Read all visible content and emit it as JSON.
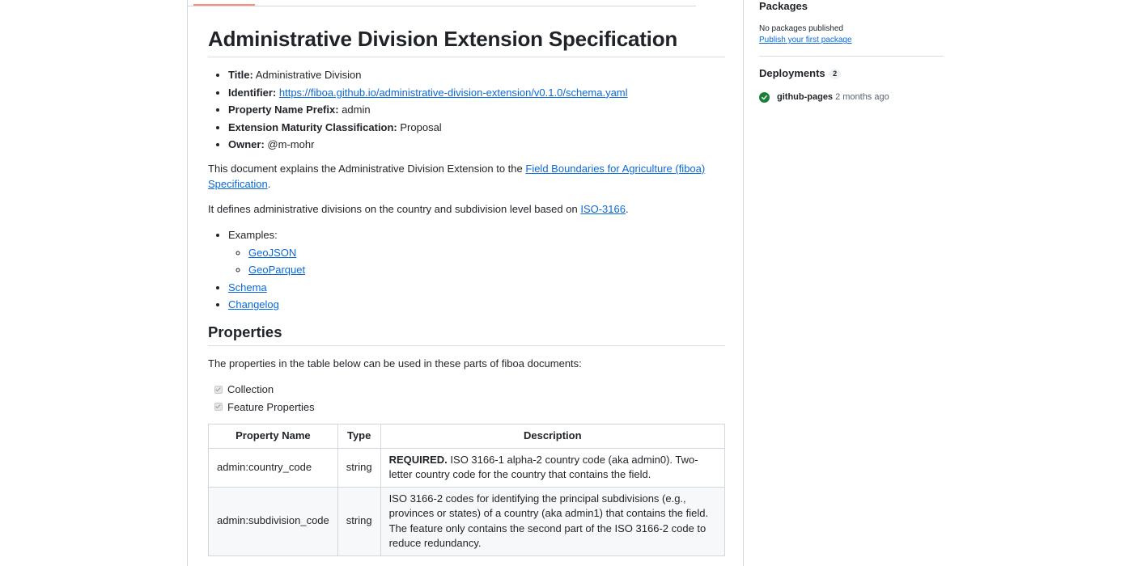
{
  "readme": {
    "title": "Administrative Division Extension Specification",
    "meta": [
      {
        "label": "Title:",
        "value": "Administrative Division"
      },
      {
        "label": "Identifier:",
        "value": "https://fiboa.github.io/administrative-division-extension/v0.1.0/schema.yaml"
      },
      {
        "label": "Property Name Prefix:",
        "value": "admin"
      },
      {
        "label": "Extension Maturity Classification:",
        "value": "Proposal"
      },
      {
        "label": "Owner:",
        "value": "@m-mohr"
      }
    ],
    "intro": {
      "before": "This document explains the Administrative Division Extension to the ",
      "link": "Field Boundaries for Agriculture (fiboa) Specification",
      "after": "."
    },
    "defines": {
      "before": "It defines administrative divisions on the country and subdivision level based on ",
      "link": "ISO-3166",
      "after": "."
    },
    "links": {
      "examples_label": "Examples:",
      "examples": [
        "GeoJSON",
        "GeoParquet"
      ],
      "schema": "Schema",
      "changelog": "Changelog"
    },
    "properties_heading": "Properties",
    "properties_intro": "The properties in the table below can be used in these parts of fiboa documents:",
    "usage": [
      "Collection",
      "Feature Properties"
    ],
    "table": {
      "headers": [
        "Property Name",
        "Type",
        "Description"
      ],
      "rows": [
        {
          "name": "admin:country_code",
          "type": "string",
          "desc_bold": "REQUIRED.",
          "desc": " ISO 3166-1 alpha-2 country code (aka admin0). Two-letter country code for the country that contains the field."
        },
        {
          "name": "admin:subdivision_code",
          "type": "string",
          "desc_bold": "",
          "desc": "ISO 3166-2 codes for identifying the principal subdivisions (e.g., provinces or states) of a country (aka admin1) that contains the field. The feature only contains the second part of the ISO 3166-2 code to reduce redundancy."
        }
      ]
    }
  },
  "sidebar": {
    "packages_title": "Packages",
    "no_packages": "No packages published",
    "publish_link": "Publish your first package",
    "deployments_title": "Deployments",
    "deployments_count": "2",
    "deployment": {
      "name": "github-pages",
      "time": "2 months ago"
    },
    "success_color": "#1a7f37"
  }
}
